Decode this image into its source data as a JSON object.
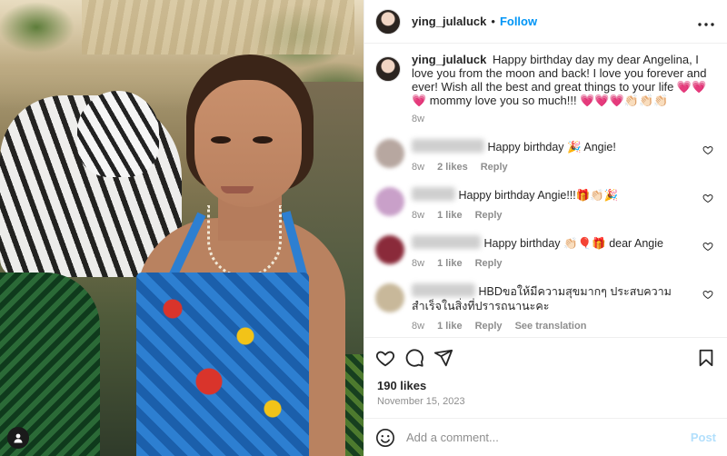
{
  "header": {
    "username": "ying_julaluck",
    "separator": "•",
    "follow_label": "Follow",
    "more_label": "•••"
  },
  "caption": {
    "username": "ying_julaluck",
    "text": "Happy birthday day my dear Angelina, I love you from the moon and back! I love you forever and ever! Wish all the best and great things to your life 💗💗💗 mommy love you so much!!! 💗💗💗👏🏻👏🏻👏🏻",
    "age": "8w"
  },
  "comments": [
    {
      "text": "Happy birthday 🎉 Angie!",
      "age": "8w",
      "likes": "2 likes",
      "reply": "Reply",
      "translation": "",
      "avatar_color": "#b7a7a0"
    },
    {
      "text": "Happy birthday Angie!!!🎁👏🏻🎉",
      "age": "8w",
      "likes": "1 like",
      "reply": "Reply",
      "translation": "",
      "avatar_color": "#c9a0c9"
    },
    {
      "text": "Happy birthday 👏🏻🎈🎁 dear Angie",
      "age": "8w",
      "likes": "1 like",
      "reply": "Reply",
      "translation": "",
      "avatar_color": "#8a2a3a"
    },
    {
      "text": "HBDขอให้มีความสุขมากๆ ประสบความสำเร็จในสิ่งที่ปรารถนานะคะ",
      "age": "8w",
      "likes": "1 like",
      "reply": "Reply",
      "translation": "See translation",
      "avatar_color": "#c8b89a"
    }
  ],
  "stats": {
    "likes": "190 likes",
    "date": "November 15, 2023"
  },
  "composer": {
    "placeholder": "Add a comment...",
    "post_label": "Post"
  },
  "colors": {
    "link_blue": "#0095f6",
    "muted": "#8e8e8e",
    "post_disabled": "#b2dffc"
  },
  "icons": {
    "header_more": "more-horizontal-icon",
    "like": "heart-icon",
    "comment": "comment-icon",
    "share": "share-icon",
    "save": "bookmark-icon",
    "emoji": "emoji-icon",
    "tag": "user-tag-icon"
  }
}
